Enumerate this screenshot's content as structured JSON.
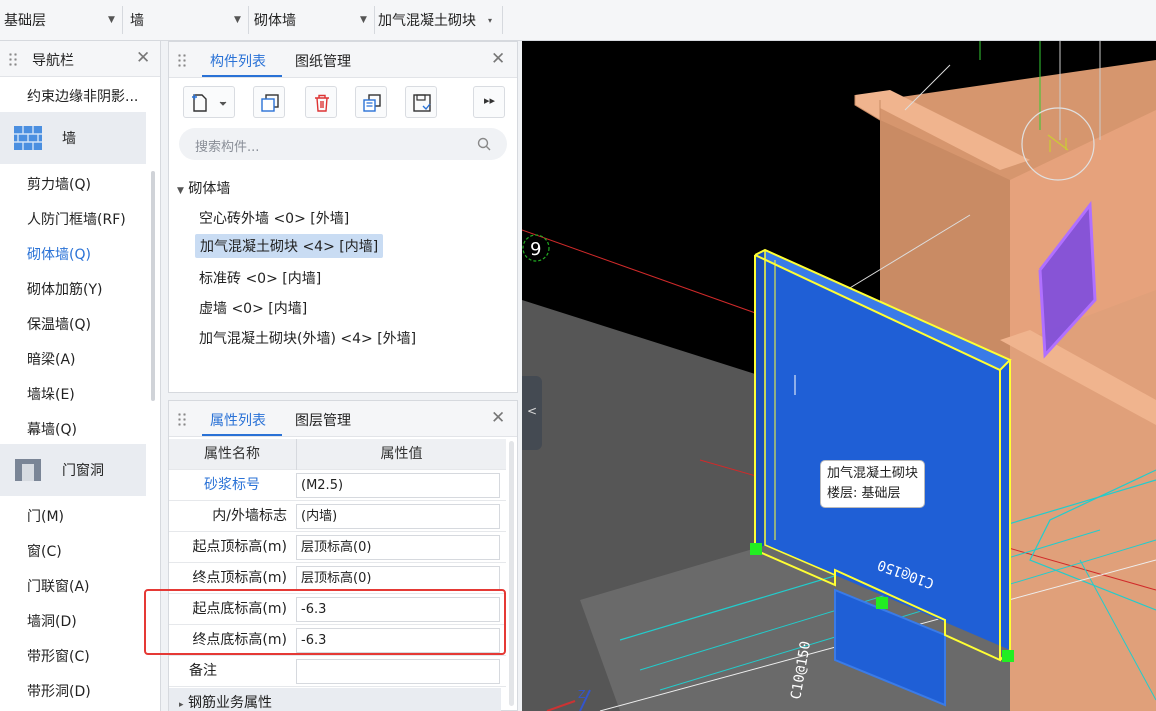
{
  "selectors": [
    {
      "label": "基础层"
    },
    {
      "label": "墙"
    },
    {
      "label": "砌体墙"
    },
    {
      "label": "加气混凝土砌块"
    }
  ],
  "nav": {
    "title": "导航栏",
    "items_top": [
      "约束边缘非阴影..."
    ],
    "group_wall": "墙",
    "wall_items": [
      "剪力墙(Q)",
      "人防门框墙(RF)",
      "砌体墙(Q)",
      "砌体加筋(Y)",
      "保温墙(Q)",
      "暗梁(A)",
      "墙垛(E)",
      "幕墙(Q)"
    ],
    "active_item": "砌体墙(Q)",
    "group_door": "门窗洞",
    "door_items": [
      "门(M)",
      "窗(C)",
      "门联窗(A)",
      "墙洞(D)",
      "带形窗(C)",
      "带形洞(D)"
    ]
  },
  "component_panel": {
    "tabs": [
      "构件列表",
      "图纸管理"
    ],
    "search_placeholder": "搜索构件...",
    "tree_root": "砌体墙",
    "items": [
      "空心砖外墙 <0> [外墙]",
      "加气混凝土砌块 <4> [内墙]",
      "标准砖 <0> [内墙]",
      "虚墙 <0> [内墙]",
      "加气混凝土砌块(外墙)   <4> [外墙]"
    ],
    "selected_index": 1
  },
  "property_panel": {
    "tabs": [
      "属性列表",
      "图层管理"
    ],
    "header": {
      "name": "属性名称",
      "value": "属性值"
    },
    "rows": [
      {
        "name": "砂浆标号",
        "value": "(M2.5)"
      },
      {
        "name": "内/外墙标志",
        "value": "(内墙)"
      },
      {
        "name": "起点顶标高(m)",
        "value": "层顶标高(0)"
      },
      {
        "name": "终点顶标高(m)",
        "value": "层顶标高(0)"
      },
      {
        "name": "起点底标高(m)",
        "value": "-6.3"
      },
      {
        "name": "终点底标高(m)",
        "value": "-6.3"
      },
      {
        "name": "备注",
        "value": ""
      }
    ],
    "group": "钢筋业务属性"
  },
  "viewport": {
    "axis_label": "9",
    "tooltip_name": "加气混凝土砌块",
    "tooltip_floor": "楼层: 基础层",
    "wall_text_1": "C10@150",
    "wall_text_2": "C10@150"
  },
  "colors": {
    "accent": "#2a72d6",
    "highlight_box": "#e53935",
    "selected_wall": "#1f5fd6",
    "wall_beige": "#e6a27c",
    "selection_outline": "#ffff33"
  }
}
